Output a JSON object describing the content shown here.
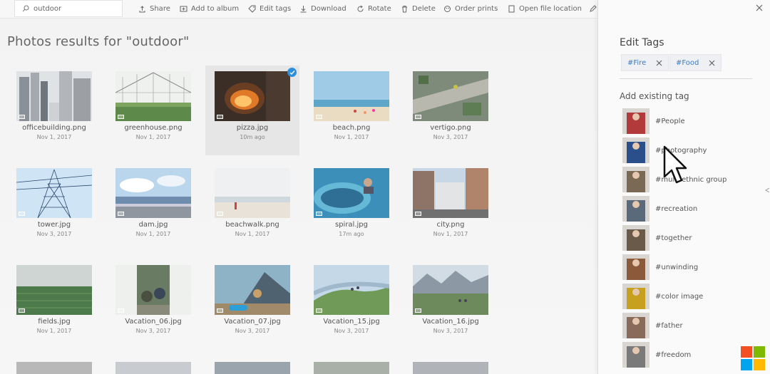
{
  "toolbar": {
    "search_value": "outdoor",
    "actions": [
      {
        "label": "Share",
        "icon": "share-icon"
      },
      {
        "label": "Add to album",
        "icon": "add-to-album-icon"
      },
      {
        "label": "Edit tags",
        "icon": "tag-icon"
      },
      {
        "label": "Download",
        "icon": "download-icon"
      },
      {
        "label": "Rotate",
        "icon": "rotate-icon"
      },
      {
        "label": "Delete",
        "icon": "trash-icon"
      },
      {
        "label": "Order prints",
        "icon": "cart-icon"
      },
      {
        "label": "Open file location",
        "icon": "file-icon"
      }
    ]
  },
  "main": {
    "title": "Photos results for \"outdoor\"",
    "photos": [
      {
        "name": "officebuilding.png",
        "date": "Nov 1, 2017",
        "thumb": "city-towers"
      },
      {
        "name": "greenhouse.png",
        "date": "Nov 1, 2017",
        "thumb": "greenhouse"
      },
      {
        "name": "pizza.jpg",
        "date": "10m ago",
        "thumb": "pizza-oven",
        "selected": true
      },
      {
        "name": "beach.png",
        "date": "Nov 1, 2017",
        "thumb": "beach"
      },
      {
        "name": "vertigo.png",
        "date": "Nov 3, 2017",
        "thumb": "aerial"
      },
      {
        "name": "tower.jpg",
        "date": "Nov 3, 2017",
        "thumb": "power-tower"
      },
      {
        "name": "dam.jpg",
        "date": "Nov 1, 2017",
        "thumb": "dam"
      },
      {
        "name": "beachwalk.png",
        "date": "Nov 1, 2017",
        "thumb": "beachwalk"
      },
      {
        "name": "spiral.jpg",
        "date": "17m ago",
        "thumb": "waterslide"
      },
      {
        "name": "city.png",
        "date": "Nov 1, 2017",
        "thumb": "city-street"
      },
      {
        "name": "fields.jpg",
        "date": "Nov 1, 2017",
        "thumb": "fields"
      },
      {
        "name": "Vacation_06.jpg",
        "date": "Nov 3, 2017",
        "thumb": "camping"
      },
      {
        "name": "Vacation_07.jpg",
        "date": "Nov 3, 2017",
        "thumb": "tent"
      },
      {
        "name": "Vacation_15.jpg",
        "date": "Nov 3, 2017",
        "thumb": "hill"
      },
      {
        "name": "Vacation_16.jpg",
        "date": "Nov 3, 2017",
        "thumb": "mountains"
      }
    ]
  },
  "panel": {
    "title": "Edit Tags",
    "chips": [
      "#Fire",
      "#Food"
    ],
    "subtitle": "Add existing tag",
    "tags": [
      {
        "label": "#People",
        "color": "#b23a3a"
      },
      {
        "label": "#photography",
        "color": "#2a4f8a"
      },
      {
        "label": "#multi ethnic group",
        "color": "#7a6a55"
      },
      {
        "label": "#recreation",
        "color": "#5a6a7a"
      },
      {
        "label": "#together",
        "color": "#6a5a4a"
      },
      {
        "label": "#unwinding",
        "color": "#8a5a3a"
      },
      {
        "label": "#color image",
        "color": "#c8a020"
      },
      {
        "label": "#father",
        "color": "#8a6a5a"
      },
      {
        "label": "#freedom",
        "color": "#7a7a7a"
      }
    ]
  },
  "colors": {
    "accent": "#3a7bc8",
    "check": "#2b8fdc"
  }
}
